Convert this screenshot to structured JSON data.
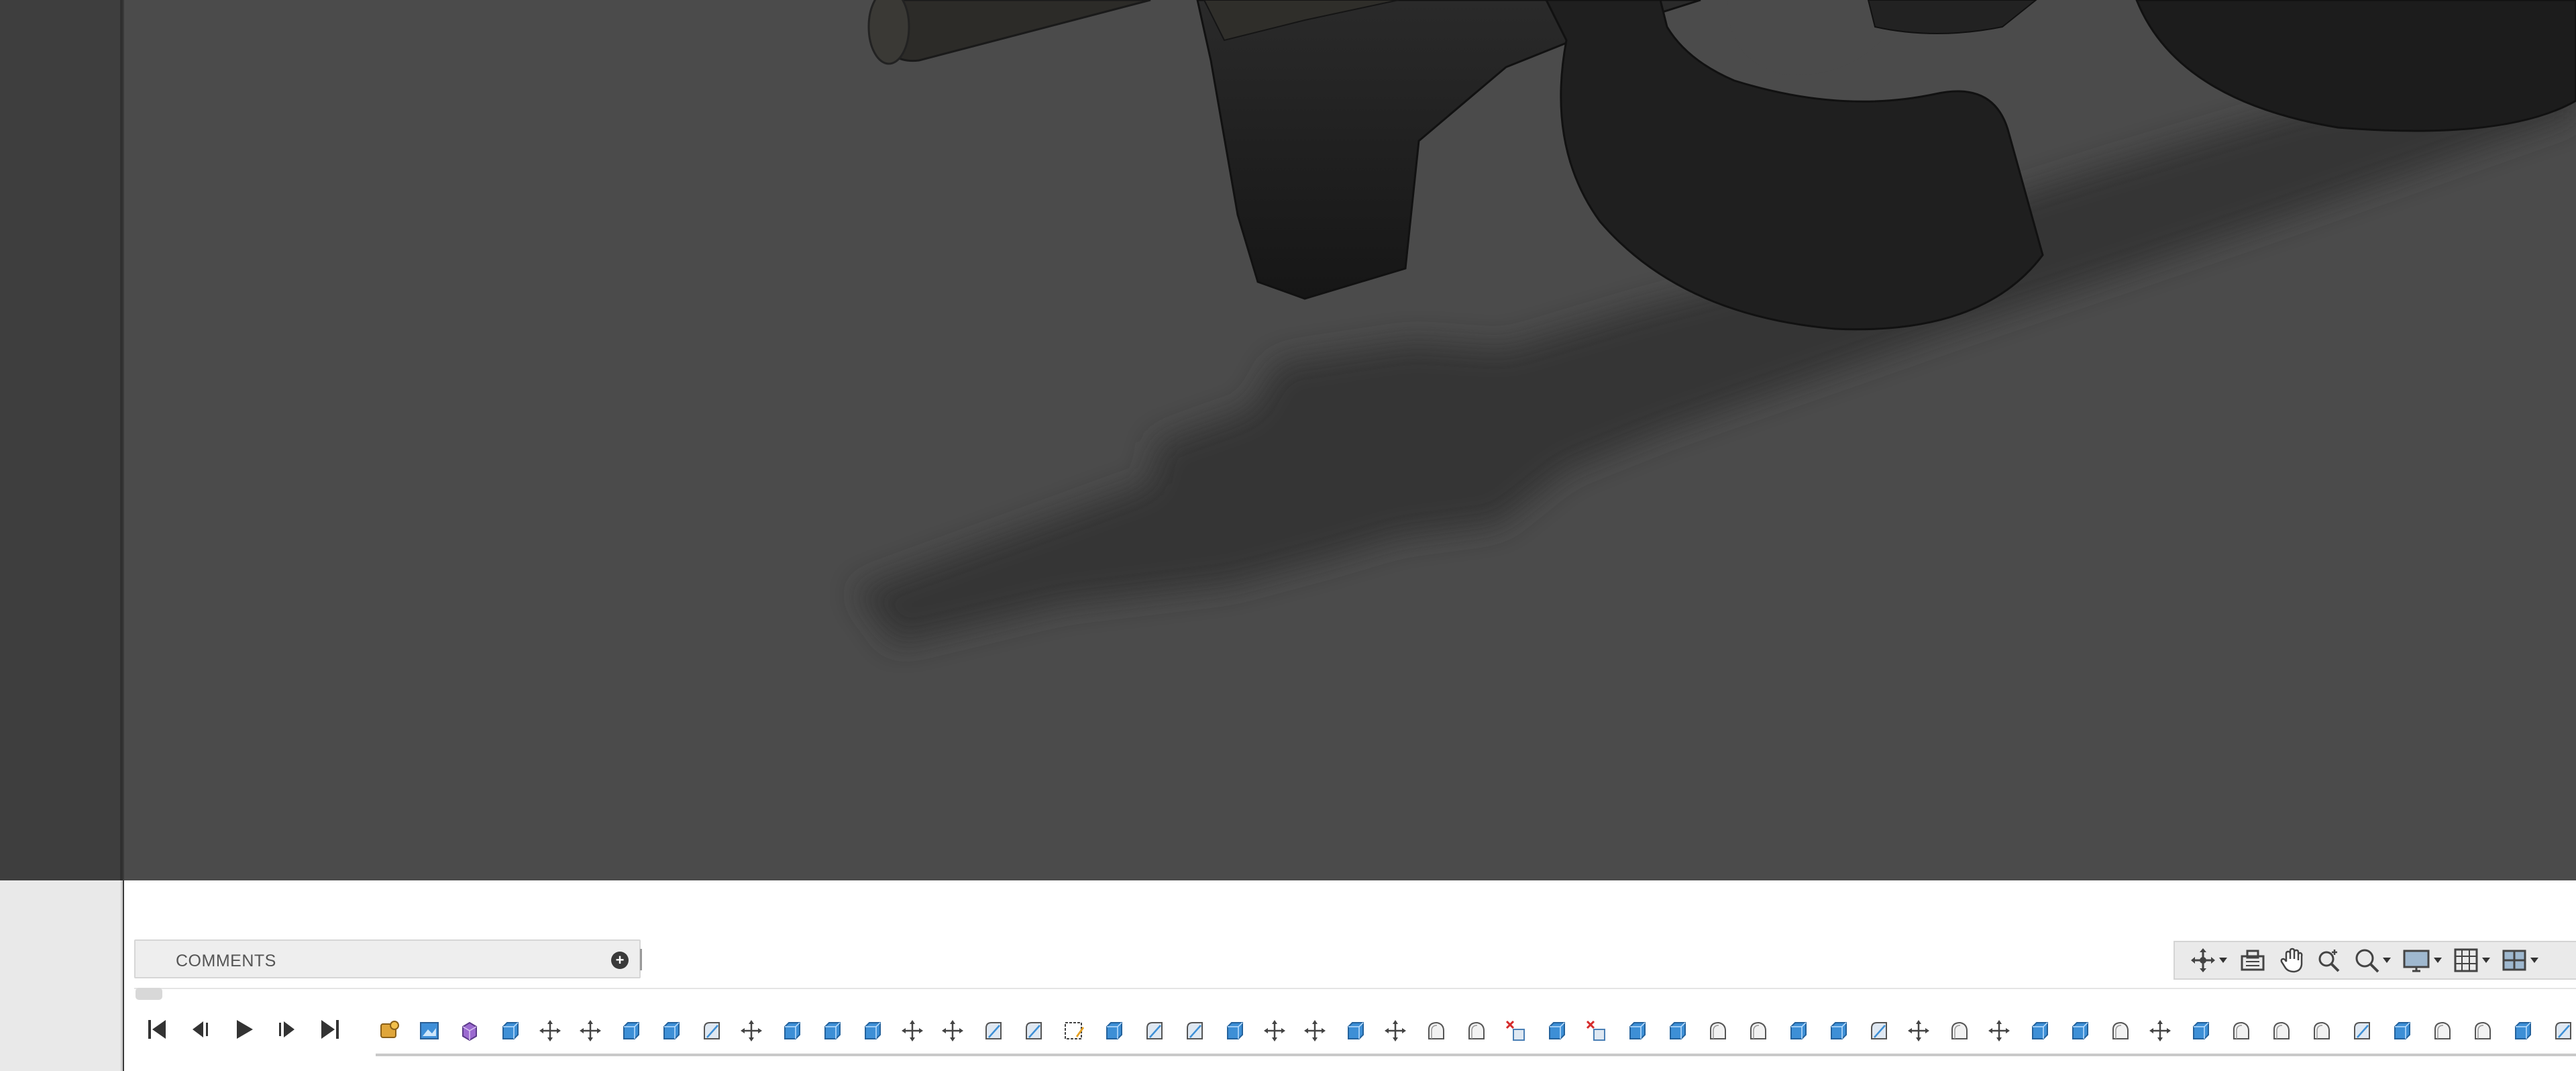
{
  "comments": {
    "label": "COMMENTS",
    "add_icon": "plus-circle-icon"
  },
  "playback": [
    {
      "name": "go-to-start-button",
      "icon": "skip-start-icon"
    },
    {
      "name": "step-back-button",
      "icon": "step-back-icon"
    },
    {
      "name": "play-button",
      "icon": "play-icon"
    },
    {
      "name": "step-forward-button",
      "icon": "step-forward-icon"
    },
    {
      "name": "go-to-end-button",
      "icon": "skip-end-icon"
    }
  ],
  "navigation_toolbar": [
    {
      "name": "orbit-button",
      "icon": "orbit-icon",
      "dropdown": true
    },
    {
      "name": "look-at-button",
      "icon": "look-at-icon",
      "dropdown": false
    },
    {
      "name": "pan-button",
      "icon": "hand-icon",
      "dropdown": false
    },
    {
      "name": "zoom-button",
      "icon": "zoom-icon",
      "dropdown": false
    },
    {
      "name": "fit-button",
      "icon": "zoom-fit-icon",
      "dropdown": true
    },
    {
      "name": "display-settings-button",
      "icon": "monitor-icon",
      "dropdown": true
    },
    {
      "name": "grid-settings-button",
      "icon": "grid-icon",
      "dropdown": true
    },
    {
      "name": "viewports-button",
      "icon": "viewports-icon",
      "dropdown": true
    }
  ],
  "timeline_features": [
    "component",
    "canvas",
    "form",
    "extrude",
    "move",
    "move",
    "extrude",
    "extrude",
    "fillet",
    "move",
    "extrude",
    "extrude",
    "extrude",
    "move",
    "move",
    "fillet",
    "fillet",
    "sketch",
    "extrude",
    "fillet",
    "fillet",
    "extrude",
    "move",
    "move",
    "extrude",
    "move",
    "shell",
    "shell",
    "delete",
    "extrude",
    "delete",
    "extrude",
    "extrude",
    "shell",
    "shell",
    "extrude",
    "extrude",
    "fillet",
    "move",
    "shell",
    "move",
    "extrude",
    "extrude",
    "shell",
    "move",
    "extrude",
    "shell",
    "shell",
    "shell",
    "fillet",
    "extrude",
    "shell",
    "shell",
    "extrude",
    "fillet"
  ],
  "colors": {
    "viewport_bg": "#4b4b4b",
    "extrude_blue": "#3d8fd6",
    "form_purple": "#9b6ad0",
    "delete_red": "#d62b2b"
  }
}
